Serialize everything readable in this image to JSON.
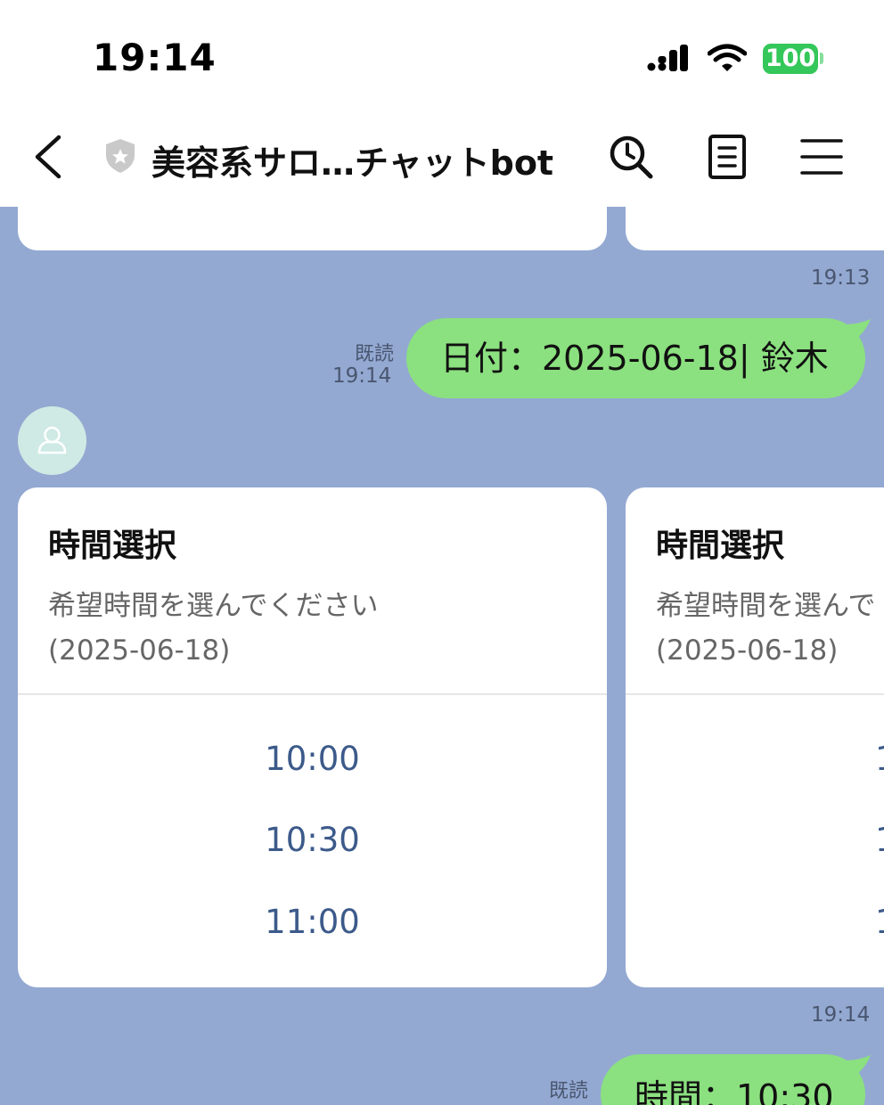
{
  "status": {
    "time": "19:14",
    "battery": "100"
  },
  "header": {
    "title": "美容系サロ…チャットbot"
  },
  "messages": {
    "top_time": "19:13",
    "sent1": {
      "read": "既読",
      "time": "19:14",
      "text": "日付：2025-06-18| 鈴木"
    },
    "cards": [
      {
        "title": "時間選択",
        "desc_line1": "希望時間を選んでください",
        "desc_line2": "(2025-06-18)",
        "options": [
          "10:00",
          "10:30",
          "11:00"
        ]
      },
      {
        "title": "時間選択",
        "desc_line1": "希望時間を選んで",
        "desc_line2": "(2025-06-18)",
        "options": [
          "1",
          "1",
          "1"
        ]
      }
    ],
    "cards_time": "19:14",
    "sent2": {
      "read": "既読",
      "text": "時間：10:30"
    }
  },
  "colors": {
    "chat_bg": "#93a9d2",
    "bubble": "#8be07f",
    "option_text": "#3c5a8a",
    "battery": "#34c759"
  }
}
